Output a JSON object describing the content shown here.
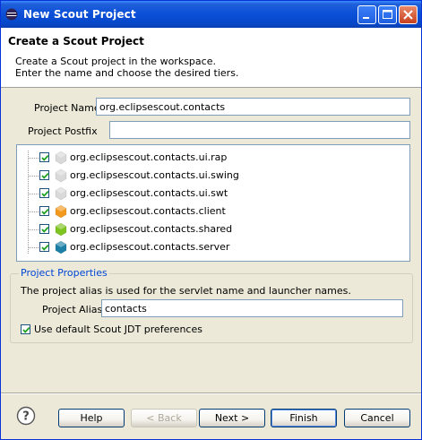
{
  "window": {
    "title": "New Scout Project"
  },
  "header": {
    "title": "Create a Scout Project",
    "line1": "Create a Scout project in the workspace.",
    "line2": "Enter the name and choose the desired tiers."
  },
  "form": {
    "project_name_label": "Project Name",
    "project_name_value": "org.eclipsescout.contacts",
    "project_postfix_label": "Project Postfix",
    "project_postfix_value": ""
  },
  "tiers": [
    {
      "label": "org.eclipsescout.contacts.ui.rap",
      "checked": true,
      "icon": "hexagon-gray-icon",
      "color": "#d9d9d9"
    },
    {
      "label": "org.eclipsescout.contacts.ui.swing",
      "checked": true,
      "icon": "hexagon-gray-icon",
      "color": "#d9d9d9"
    },
    {
      "label": "org.eclipsescout.contacts.ui.swt",
      "checked": true,
      "icon": "hexagon-gray-icon",
      "color": "#d9d9d9"
    },
    {
      "label": "org.eclipsescout.contacts.client",
      "checked": true,
      "icon": "hexagon-orange-icon",
      "color": "#f39a1e"
    },
    {
      "label": "org.eclipsescout.contacts.shared",
      "checked": true,
      "icon": "hexagon-green-icon",
      "color": "#7ec41f"
    },
    {
      "label": "org.eclipsescout.contacts.server",
      "checked": true,
      "icon": "hexagon-teal-icon",
      "color": "#1b7fa6"
    }
  ],
  "properties": {
    "legend": "Project Properties",
    "description": "The project alias is used for the servlet name and launcher names.",
    "alias_label": "Project Alias",
    "alias_value": "contacts",
    "jdt_label": "Use default Scout JDT preferences",
    "jdt_checked": true
  },
  "buttons": {
    "help": "Help",
    "back": "< Back",
    "next": "Next >",
    "finish": "Finish",
    "cancel": "Cancel"
  },
  "colors": {
    "titlebar": "#0a4fd8",
    "legend": "#0046d5",
    "dialog_bg": "#ece9d8"
  }
}
